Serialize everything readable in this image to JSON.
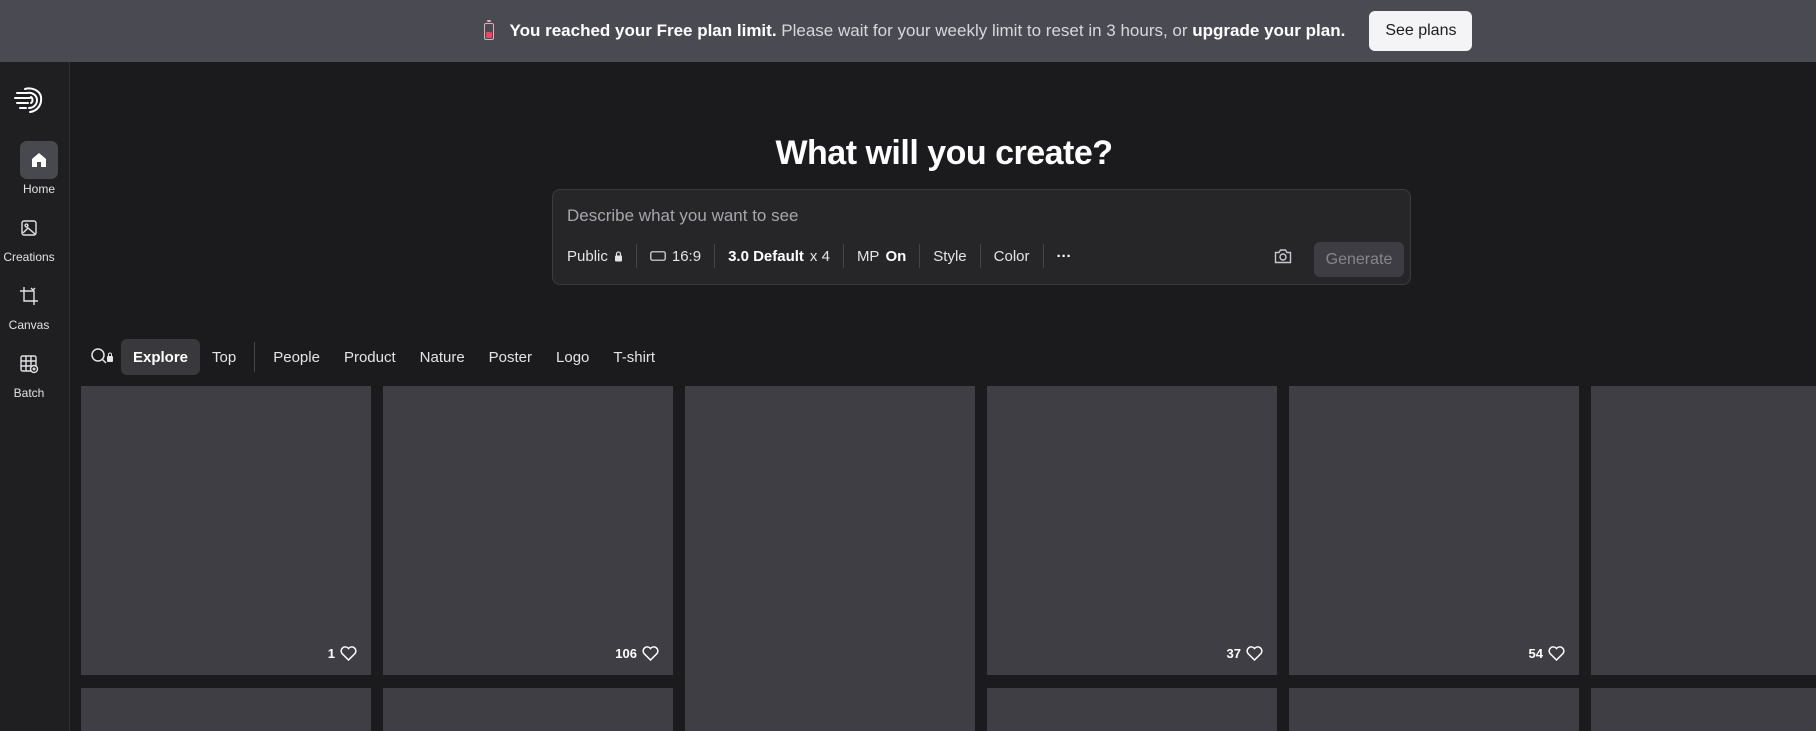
{
  "banner": {
    "bold1": "You reached your Free plan limit.",
    "text": " Please wait for your weekly limit to reset in 3 hours, or ",
    "bold2": "upgrade your plan.",
    "button": "See plans"
  },
  "sidebar": {
    "items": [
      {
        "label": "Home",
        "icon": "home-icon"
      },
      {
        "label": "Creations",
        "icon": "image-icon"
      },
      {
        "label": "Canvas",
        "icon": "crop-icon"
      },
      {
        "label": "Batch",
        "icon": "grid-icon"
      }
    ]
  },
  "main": {
    "headline": "What will you create?",
    "prompt": {
      "placeholder": "Describe what you want to see",
      "visibility": "Public",
      "aspect": "16:9",
      "model": "3.0 Default",
      "count": "x 4",
      "mp_label": "MP",
      "mp_value": "On",
      "style": "Style",
      "color": "Color",
      "more": "···",
      "generate": "Generate"
    },
    "filters": [
      "Explore",
      "Top",
      "People",
      "Product",
      "Nature",
      "Poster",
      "Logo",
      "T-shirt"
    ],
    "cards": [
      {
        "likes": "1"
      },
      {
        "likes": "106"
      },
      {
        "likes": ""
      },
      {
        "likes": "37"
      },
      {
        "likes": "54"
      },
      {
        "likes": ""
      }
    ]
  },
  "colors": {
    "banner_bg": "#4a4a52",
    "page_bg": "#1b1b1d",
    "card_bg": "#3e3e44",
    "accent_battery": "#e2476d"
  }
}
